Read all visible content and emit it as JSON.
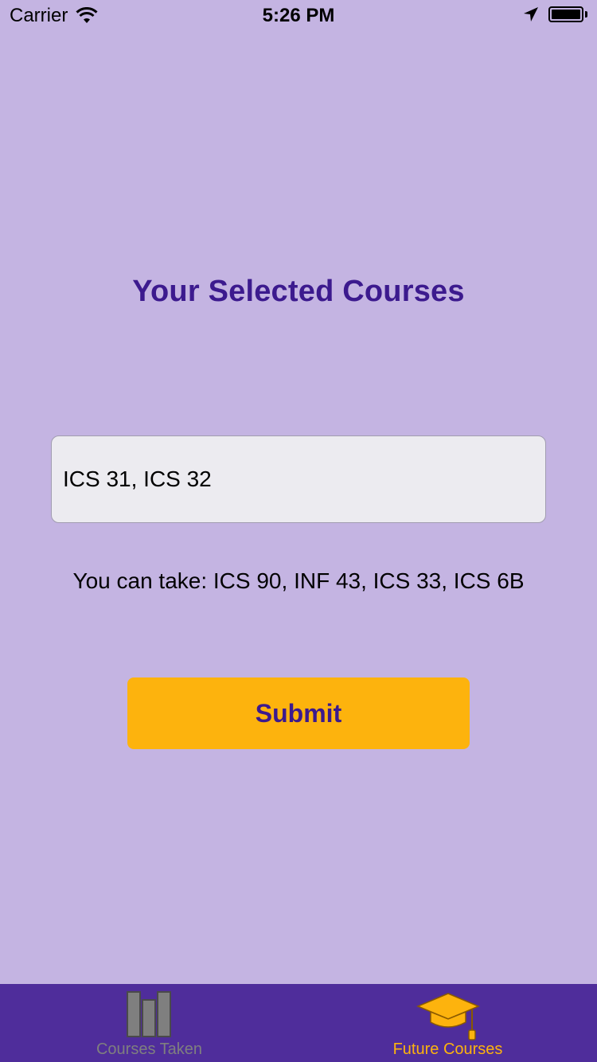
{
  "status_bar": {
    "carrier": "Carrier",
    "time": "5:26 PM"
  },
  "main": {
    "title": "Your Selected Courses",
    "courses_input_value": "ICS 31, ICS 32",
    "result_text": "You can take: ICS 90, INF 43, ICS 33, ICS 6B",
    "submit_label": "Submit"
  },
  "tab_bar": {
    "tabs": [
      {
        "label": "Courses Taken",
        "icon": "books-icon",
        "active": false
      },
      {
        "label": "Future Courses",
        "icon": "graduation-cap-icon",
        "active": true
      }
    ]
  },
  "colors": {
    "background": "#c4b4e2",
    "title": "#3c1a8e",
    "accent": "#fdb30d",
    "tab_bar": "#4f2d9b",
    "tab_inactive": "#7f7f7f"
  }
}
